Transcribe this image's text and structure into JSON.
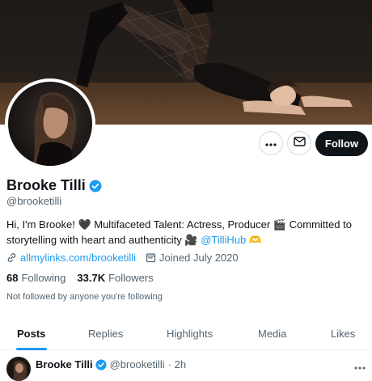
{
  "banner": {
    "icon": "banner-photo"
  },
  "profile": {
    "display_name": "Brooke Tilli",
    "handle": "@brooketilli",
    "bio_text": "Hi, I'm Brooke! 🖤 Multifaceted Talent: Actress, Producer 🎬 Committed to storytelling with heart and authenticity 🎥 ",
    "bio_mention": "@TilliHub",
    "bio_emoji": "🫶",
    "website": "allmylinks.com/brooketilli",
    "joined": "Joined July 2020",
    "following_count": "68",
    "following_label": "Following",
    "followers_count": "33.7K",
    "followers_label": "Followers",
    "not_followed_text": "Not followed by anyone you're following"
  },
  "actions": {
    "follow_label": "Follow"
  },
  "tabs": [
    {
      "label": "Posts",
      "active": true
    },
    {
      "label": "Replies",
      "active": false
    },
    {
      "label": "Highlights",
      "active": false
    },
    {
      "label": "Media",
      "active": false
    },
    {
      "label": "Likes",
      "active": false
    }
  ],
  "post": {
    "name": "Brooke Tilli",
    "handle": "@brooketilli",
    "time": "· 2h"
  },
  "colors": {
    "accent": "#1d9bf0",
    "text": "#0f1419",
    "muted": "#536471",
    "follow_bg": "#0f1419"
  }
}
